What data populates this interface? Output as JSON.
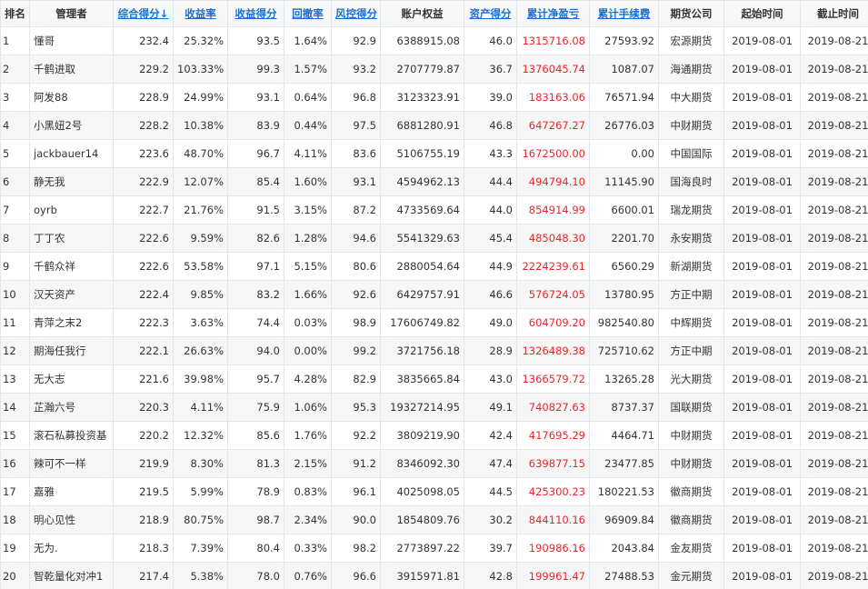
{
  "colors": {
    "link": "#1a6fd1",
    "profit": "#e8262a",
    "border": "#dfe6ee",
    "header_bg": "#f7f7f7"
  },
  "columns": [
    {
      "key": "rank",
      "label": "排名",
      "sortable": false
    },
    {
      "key": "manager",
      "label": "管理者",
      "sortable": false
    },
    {
      "key": "score",
      "label": "综合得分↓",
      "sortable": true
    },
    {
      "key": "return_rate",
      "label": "收益率",
      "sortable": true
    },
    {
      "key": "return_score",
      "label": "收益得分",
      "sortable": true
    },
    {
      "key": "drawdown",
      "label": "回撤率",
      "sortable": true
    },
    {
      "key": "risk_score",
      "label": "风控得分",
      "sortable": true
    },
    {
      "key": "equity",
      "label": "账户权益",
      "sortable": false
    },
    {
      "key": "asset_score",
      "label": "资产得分",
      "sortable": true
    },
    {
      "key": "net_profit",
      "label": "累计净盈亏",
      "sortable": true
    },
    {
      "key": "fees",
      "label": "累计手续费",
      "sortable": true
    },
    {
      "key": "broker",
      "label": "期货公司",
      "sortable": false
    },
    {
      "key": "start",
      "label": "起始时间",
      "sortable": false
    },
    {
      "key": "end",
      "label": "截止时间",
      "sortable": false
    }
  ],
  "rows": [
    [
      "1",
      "懂哥",
      "232.4",
      "25.32%",
      "93.5",
      "1.64%",
      "92.9",
      "6388915.08",
      "46.0",
      "1315716.08",
      "27593.92",
      "宏源期货",
      "2019-08-01",
      "2019-08-21"
    ],
    [
      "2",
      "千鹤进取",
      "229.2",
      "103.33%",
      "99.3",
      "1.57%",
      "93.2",
      "2707779.87",
      "36.7",
      "1376045.74",
      "1087.07",
      "海通期货",
      "2019-08-01",
      "2019-08-21"
    ],
    [
      "3",
      "阿发88",
      "228.9",
      "24.99%",
      "93.1",
      "0.64%",
      "96.8",
      "3123323.91",
      "39.0",
      "183163.06",
      "76571.94",
      "中大期货",
      "2019-08-01",
      "2019-08-21"
    ],
    [
      "4",
      "小黑妞2号",
      "228.2",
      "10.38%",
      "83.9",
      "0.44%",
      "97.5",
      "6881280.91",
      "46.8",
      "647267.27",
      "26776.03",
      "中财期货",
      "2019-08-01",
      "2019-08-21"
    ],
    [
      "5",
      "jackbauer14",
      "223.6",
      "48.70%",
      "96.7",
      "4.11%",
      "83.6",
      "5106755.19",
      "43.3",
      "1672500.00",
      "0.00",
      "中国国际",
      "2019-08-01",
      "2019-08-21"
    ],
    [
      "6",
      "静无我",
      "222.9",
      "12.07%",
      "85.4",
      "1.60%",
      "93.1",
      "4594962.13",
      "44.4",
      "494794.10",
      "11145.90",
      "国海良时",
      "2019-08-01",
      "2019-08-21"
    ],
    [
      "7",
      "oyrb",
      "222.7",
      "21.76%",
      "91.5",
      "3.15%",
      "87.2",
      "4733569.64",
      "44.0",
      "854914.99",
      "6600.01",
      "瑞龙期货",
      "2019-08-01",
      "2019-08-21"
    ],
    [
      "8",
      "丁丁农",
      "222.6",
      "9.59%",
      "82.6",
      "1.28%",
      "94.6",
      "5541329.63",
      "45.4",
      "485048.30",
      "2201.70",
      "永安期货",
      "2019-08-01",
      "2019-08-21"
    ],
    [
      "9",
      "千鹤众祥",
      "222.6",
      "53.58%",
      "97.1",
      "5.15%",
      "80.6",
      "2880054.64",
      "44.9",
      "2224239.61",
      "6560.29",
      "新湖期货",
      "2019-08-01",
      "2019-08-21"
    ],
    [
      "10",
      "汉天资产",
      "222.4",
      "9.85%",
      "83.2",
      "1.66%",
      "92.6",
      "6429757.91",
      "46.6",
      "576724.05",
      "13780.95",
      "方正中期",
      "2019-08-01",
      "2019-08-21"
    ],
    [
      "11",
      "青萍之末2",
      "222.3",
      "3.63%",
      "74.4",
      "0.03%",
      "98.9",
      "17606749.82",
      "49.0",
      "604709.20",
      "982540.80",
      "中辉期货",
      "2019-08-01",
      "2019-08-21"
    ],
    [
      "12",
      "期海任我行",
      "222.1",
      "26.63%",
      "94.0",
      "0.00%",
      "99.2",
      "3721756.18",
      "28.9",
      "1326489.38",
      "725710.62",
      "方正中期",
      "2019-08-01",
      "2019-08-21"
    ],
    [
      "13",
      "无大志",
      "221.6",
      "39.98%",
      "95.7",
      "4.28%",
      "82.9",
      "3835665.84",
      "43.0",
      "1366579.72",
      "13265.28",
      "光大期货",
      "2019-08-01",
      "2019-08-21"
    ],
    [
      "14",
      "芷瀚六号",
      "220.3",
      "4.11%",
      "75.9",
      "1.06%",
      "95.3",
      "19327214.95",
      "49.1",
      "740827.63",
      "8737.37",
      "国联期货",
      "2019-08-01",
      "2019-08-21"
    ],
    [
      "15",
      "滚石私募投资基",
      "220.2",
      "12.32%",
      "85.6",
      "1.76%",
      "92.2",
      "3809219.90",
      "42.4",
      "417695.29",
      "4464.71",
      "中财期货",
      "2019-08-01",
      "2019-08-21"
    ],
    [
      "16",
      "辣可不一样",
      "219.9",
      "8.30%",
      "81.3",
      "2.15%",
      "91.2",
      "8346092.30",
      "47.4",
      "639877.15",
      "23477.85",
      "中财期货",
      "2019-08-01",
      "2019-08-21"
    ],
    [
      "17",
      "嘉雅",
      "219.5",
      "5.99%",
      "78.9",
      "0.83%",
      "96.1",
      "4025098.05",
      "44.5",
      "425300.23",
      "180221.53",
      "徽商期货",
      "2019-08-01",
      "2019-08-21"
    ],
    [
      "18",
      "明心见性",
      "218.9",
      "80.75%",
      "98.7",
      "2.34%",
      "90.0",
      "1854809.76",
      "30.2",
      "844110.16",
      "96909.84",
      "徽商期货",
      "2019-08-01",
      "2019-08-21"
    ],
    [
      "19",
      "无为.",
      "218.3",
      "7.39%",
      "80.4",
      "0.33%",
      "98.2",
      "2773897.22",
      "39.7",
      "190986.16",
      "2043.84",
      "金友期货",
      "2019-08-01",
      "2019-08-21"
    ],
    [
      "20",
      "智乾量化对冲1",
      "217.4",
      "5.38%",
      "78.0",
      "0.76%",
      "96.6",
      "3915971.81",
      "42.8",
      "199961.47",
      "27488.53",
      "金元期货",
      "2019-08-01",
      "2019-08-21"
    ]
  ]
}
